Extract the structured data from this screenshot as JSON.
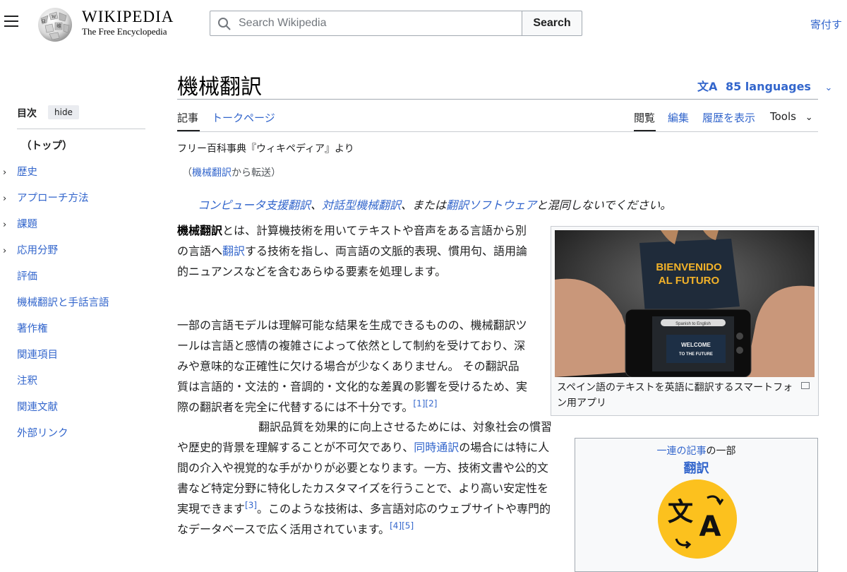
{
  "header": {
    "wordmark_title": "WIKIPEDIA",
    "wordmark_tagline": "The Free Encyclopedia",
    "search_placeholder": "Search Wikipedia",
    "search_button": "Search",
    "donate": "寄付す"
  },
  "toc": {
    "heading": "目次",
    "hide": "hide",
    "items": [
      {
        "label": "（トップ）",
        "expandable": false
      },
      {
        "label": "歴史",
        "expandable": true
      },
      {
        "label": "アプローチ方法",
        "expandable": true
      },
      {
        "label": "課題",
        "expandable": true
      },
      {
        "label": "応用分野",
        "expandable": true
      },
      {
        "label": "評価",
        "expandable": false
      },
      {
        "label": "機械翻訳と手話言語",
        "expandable": false
      },
      {
        "label": "著作権",
        "expandable": false
      },
      {
        "label": "関連項目",
        "expandable": false
      },
      {
        "label": "注釈",
        "expandable": false
      },
      {
        "label": "関連文献",
        "expandable": false
      },
      {
        "label": "外部リンク",
        "expandable": false
      }
    ]
  },
  "article": {
    "title": "機械翻訳",
    "languages": "85 languages",
    "tabs_left": [
      "記事",
      "トークページ"
    ],
    "tabs_right": [
      "閲覧",
      "編集",
      "履歴を表示",
      "Tools"
    ],
    "from": "フリー百科事典『ウィキペディア』より",
    "redirect": {
      "open": "（",
      "link": "機械翻訳",
      "rest": "から転送）"
    },
    "hatnote": {
      "link1": "コンピュータ支援翻訳",
      "sep1": "、",
      "link2": "対話型機械翻訳",
      "sep2": "、または",
      "link3": "翻訳ソフトウェア",
      "rest": "と混同しないでください。"
    },
    "p1": {
      "bold": "機械翻訳",
      "t1": "とは、計算機技術を用いてテキストや音声をある言語から別の言語へ",
      "link": "翻訳",
      "t2": "する技術を指し、両言語の文脈的表現、慣用句、語用論的ニュアンスなどを含むあらゆる要素を処理します。"
    },
    "p2": {
      "t1": "一部の言語モデルは理解可能な結果を生成できるものの、機械翻訳ツールは言語と感情の複雑さによって依然として制約を受けており、深みや意味的な正確性に欠ける場合が少なくありません。 その翻訳品質は言語的・文法的・音調的・文化的な差異の影響を受けるため、実際の翻訳者を完全に代替するには不十分です。",
      "ref1": "[1]",
      "ref2": "[2]",
      "t2": " 翻訳品質を効果的に向上させるためには、対象社会の慣習や歴史的背景を理解することが不可欠であり、",
      "link": "同時通訳",
      "t3": "の場合には特に人間の介入や視覚的な手がかりが必要となります。一方、技術文書や公的文書など特定分野に特化したカスタマイズを行うことで、より高い安定性を実現できます",
      "ref3": "[3]",
      "t4": "。このような技術は、多言語対応のウェブサイトや専門的なデータベースで広く活用されています。",
      "ref4": "[4]",
      "ref5": "[5]"
    },
    "figure": {
      "sign_line1": "BIENVENIDO",
      "sign_line2": "AL FUTURO",
      "phone_bar": "Spanish to English",
      "phone_line1": "WELCOME",
      "phone_line2": "TO THE FUTURE",
      "caption": "スペイン語のテキストを英語に翻訳するスマートフォン用アプリ"
    },
    "series": {
      "link": "一連の記事",
      "rest": "の一部",
      "title": "翻訳"
    }
  }
}
